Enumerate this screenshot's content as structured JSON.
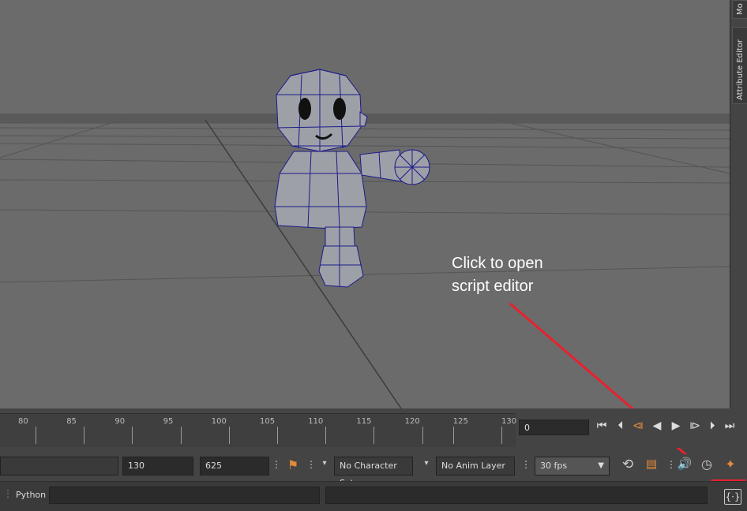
{
  "annotation": {
    "text": "Click to open\nscript editor",
    "arrow_color": "#e8212e"
  },
  "right_panel": {
    "tab_top": "Mo",
    "tab_attribute_editor": "Attribute Editor"
  },
  "timeline": {
    "ticks": [
      "80",
      "85",
      "90",
      "95",
      "100",
      "105",
      "110",
      "115",
      "120",
      "125",
      "130"
    ],
    "current_frame": "0"
  },
  "range": {
    "end_time": "130",
    "anim_end": "625",
    "character_set": "No Character Set",
    "anim_layer": "No Anim Layer",
    "fps": "30 fps"
  },
  "command_line": {
    "language": "Python",
    "input_placeholder": ""
  },
  "icons": {
    "go_start": "skip-back-icon",
    "step_back_key": "step-back-key-icon",
    "step_back": "step-back-icon",
    "play_back": "play-backward-icon",
    "play_forward": "play-forward-icon",
    "step_forward_key": "step-forward-key-icon",
    "step_forward": "step-forward-icon",
    "go_end": "skip-forward-icon",
    "loop": "loop-icon",
    "playblast": "playblast-icon",
    "sound": "sound-icon",
    "anim_prefs": "anim-prefs-icon",
    "character": "running-man-icon",
    "script_editor": "script-editor-icon"
  },
  "colors": {
    "mesh_wire": "#1b1b8a",
    "mesh_fill": "#9ea0a8",
    "highlight_box": "#e8212e"
  }
}
